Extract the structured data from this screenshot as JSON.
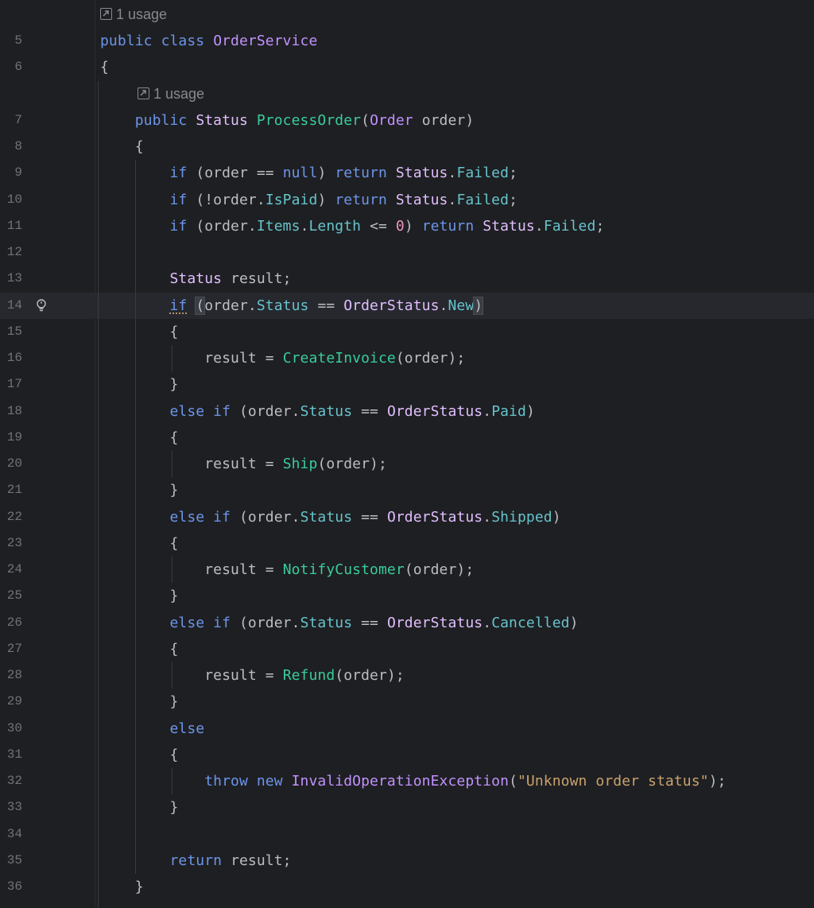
{
  "editor": {
    "usage_hints": [
      "1 usage",
      "1 usage"
    ],
    "lines": [
      {
        "n": "5",
        "t": [
          [
            "kw",
            "public "
          ],
          [
            "kw",
            "class "
          ],
          [
            "cls",
            "OrderService"
          ]
        ]
      },
      {
        "n": "6",
        "t": [
          [
            "pl",
            "{"
          ]
        ]
      },
      {
        "n": "7",
        "t": [
          [
            "pl",
            "    "
          ],
          [
            "kw",
            "public "
          ],
          [
            "typ",
            "Status "
          ],
          [
            "mth",
            "ProcessOrder"
          ],
          [
            "pl",
            "("
          ],
          [
            "cls",
            "Order "
          ],
          [
            "pl",
            "order)"
          ]
        ]
      },
      {
        "n": "8",
        "t": [
          [
            "pl",
            "    {"
          ]
        ]
      },
      {
        "n": "9",
        "t": [
          [
            "pl",
            "        "
          ],
          [
            "kw",
            "if "
          ],
          [
            "pl",
            "(order == "
          ],
          [
            "kw",
            "null"
          ],
          [
            "pl",
            ") "
          ],
          [
            "kw",
            "return "
          ],
          [
            "typ",
            "Status"
          ],
          [
            "pl",
            "."
          ],
          [
            "fld",
            "Failed"
          ],
          [
            "pl",
            ";"
          ]
        ]
      },
      {
        "n": "10",
        "t": [
          [
            "pl",
            "        "
          ],
          [
            "kw",
            "if "
          ],
          [
            "pl",
            "(!order."
          ],
          [
            "fld",
            "IsPaid"
          ],
          [
            "pl",
            ") "
          ],
          [
            "kw",
            "return "
          ],
          [
            "typ",
            "Status"
          ],
          [
            "pl",
            "."
          ],
          [
            "fld",
            "Failed"
          ],
          [
            "pl",
            ";"
          ]
        ]
      },
      {
        "n": "11",
        "t": [
          [
            "pl",
            "        "
          ],
          [
            "kw",
            "if "
          ],
          [
            "pl",
            "(order."
          ],
          [
            "fld",
            "Items"
          ],
          [
            "pl",
            "."
          ],
          [
            "fld",
            "Length "
          ],
          [
            "pl",
            "<= "
          ],
          [
            "num",
            "0"
          ],
          [
            "pl",
            ") "
          ],
          [
            "kw",
            "return "
          ],
          [
            "typ",
            "Status"
          ],
          [
            "pl",
            "."
          ],
          [
            "fld",
            "Failed"
          ],
          [
            "pl",
            ";"
          ]
        ]
      },
      {
        "n": "12",
        "t": []
      },
      {
        "n": "13",
        "t": [
          [
            "pl",
            "        "
          ],
          [
            "typ",
            "Status "
          ],
          [
            "pl",
            "result;"
          ]
        ]
      },
      {
        "n": "14",
        "t": [
          [
            "pl",
            "        "
          ],
          [
            "kw warn",
            "if"
          ],
          [
            "pl",
            " "
          ],
          [
            "pl paren-hl",
            "("
          ],
          [
            "pl",
            "order."
          ],
          [
            "fld",
            "Status "
          ],
          [
            "pl",
            "== "
          ],
          [
            "typ",
            "OrderStatus"
          ],
          [
            "pl",
            "."
          ],
          [
            "fld",
            "New"
          ],
          [
            "pl paren-hl",
            ")"
          ]
        ]
      },
      {
        "n": "15",
        "t": [
          [
            "pl",
            "        {"
          ]
        ]
      },
      {
        "n": "16",
        "t": [
          [
            "pl",
            "            result = "
          ],
          [
            "mth",
            "CreateInvoice"
          ],
          [
            "pl",
            "(order);"
          ]
        ]
      },
      {
        "n": "17",
        "t": [
          [
            "pl",
            "        }"
          ]
        ]
      },
      {
        "n": "18",
        "t": [
          [
            "pl",
            "        "
          ],
          [
            "kw",
            "else if "
          ],
          [
            "pl",
            "(order."
          ],
          [
            "fld",
            "Status "
          ],
          [
            "pl",
            "== "
          ],
          [
            "typ",
            "OrderStatus"
          ],
          [
            "pl",
            "."
          ],
          [
            "fld",
            "Paid"
          ],
          [
            "pl",
            ")"
          ]
        ]
      },
      {
        "n": "19",
        "t": [
          [
            "pl",
            "        {"
          ]
        ]
      },
      {
        "n": "20",
        "t": [
          [
            "pl",
            "            result = "
          ],
          [
            "mth",
            "Ship"
          ],
          [
            "pl",
            "(order);"
          ]
        ]
      },
      {
        "n": "21",
        "t": [
          [
            "pl",
            "        }"
          ]
        ]
      },
      {
        "n": "22",
        "t": [
          [
            "pl",
            "        "
          ],
          [
            "kw",
            "else if "
          ],
          [
            "pl",
            "(order."
          ],
          [
            "fld",
            "Status "
          ],
          [
            "pl",
            "== "
          ],
          [
            "typ",
            "OrderStatus"
          ],
          [
            "pl",
            "."
          ],
          [
            "fld",
            "Shipped"
          ],
          [
            "pl",
            ")"
          ]
        ]
      },
      {
        "n": "23",
        "t": [
          [
            "pl",
            "        {"
          ]
        ]
      },
      {
        "n": "24",
        "t": [
          [
            "pl",
            "            result = "
          ],
          [
            "mth",
            "NotifyCustomer"
          ],
          [
            "pl",
            "(order);"
          ]
        ]
      },
      {
        "n": "25",
        "t": [
          [
            "pl",
            "        }"
          ]
        ]
      },
      {
        "n": "26",
        "t": [
          [
            "pl",
            "        "
          ],
          [
            "kw",
            "else if "
          ],
          [
            "pl",
            "(order."
          ],
          [
            "fld",
            "Status "
          ],
          [
            "pl",
            "== "
          ],
          [
            "typ",
            "OrderStatus"
          ],
          [
            "pl",
            "."
          ],
          [
            "fld",
            "Cancelled"
          ],
          [
            "pl",
            ")"
          ]
        ]
      },
      {
        "n": "27",
        "t": [
          [
            "pl",
            "        {"
          ]
        ]
      },
      {
        "n": "28",
        "t": [
          [
            "pl",
            "            result = "
          ],
          [
            "mth",
            "Refund"
          ],
          [
            "pl",
            "(order);"
          ]
        ]
      },
      {
        "n": "29",
        "t": [
          [
            "pl",
            "        }"
          ]
        ]
      },
      {
        "n": "30",
        "t": [
          [
            "pl",
            "        "
          ],
          [
            "kw",
            "else"
          ]
        ]
      },
      {
        "n": "31",
        "t": [
          [
            "pl",
            "        {"
          ]
        ]
      },
      {
        "n": "32",
        "t": [
          [
            "pl",
            "            "
          ],
          [
            "kw",
            "throw "
          ],
          [
            "kw",
            "new "
          ],
          [
            "cls",
            "InvalidOperationException"
          ],
          [
            "pl",
            "("
          ],
          [
            "str",
            "\"Unknown order status\""
          ],
          [
            "pl",
            ");"
          ]
        ]
      },
      {
        "n": "33",
        "t": [
          [
            "pl",
            "        }"
          ]
        ]
      },
      {
        "n": "34",
        "t": []
      },
      {
        "n": "35",
        "t": [
          [
            "pl",
            "        "
          ],
          [
            "kw",
            "return "
          ],
          [
            "pl",
            "result;"
          ]
        ]
      },
      {
        "n": "36",
        "t": [
          [
            "pl",
            "    }"
          ]
        ]
      }
    ]
  },
  "colors": {
    "background": "#1e1f22",
    "keyword": "#6c95eb",
    "class": "#c191ff",
    "type": "#e1bfff",
    "method": "#39cc9b",
    "field": "#66c3cc",
    "string": "#c9a26d",
    "number": "#ed94c0",
    "plain": "#bcbec4",
    "line_number": "#6f737a"
  },
  "icons": {
    "gutter_line_14": "lightbulb-icon",
    "usage_hint": "external-arrow-icon"
  }
}
